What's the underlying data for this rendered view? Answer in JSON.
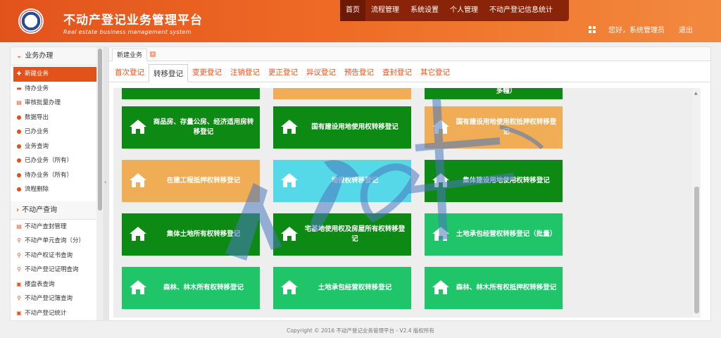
{
  "app": {
    "title": "不动产登记业务管理平台",
    "subtitle": "Real estate business management system"
  },
  "topnav": {
    "items": [
      "首页",
      "流程管理",
      "系统设置",
      "个人管理",
      "不动产登记信息统计"
    ]
  },
  "user": {
    "greeting": "您好，系统管理员",
    "logout": "退出"
  },
  "sidebar": {
    "section1": {
      "title": "业务办理",
      "items": [
        "新建业务",
        "待办业务",
        "审核批量办理",
        "数据导出",
        "已办业务",
        "业务查询",
        "已办业务（所有）",
        "待办业务（所有）",
        "流程删除"
      ]
    },
    "section2": {
      "title": "不动产查询",
      "items": [
        "不动产查封管理",
        "不动产单元查询（分）",
        "不动产权证书查询",
        "不动产登记证明查询",
        "楼盘表查询",
        "不动产登记簿查询",
        "不动产登记统计"
      ]
    }
  },
  "page_tab": {
    "label": "新建业务",
    "close": "x"
  },
  "subtabs": [
    "首次登记",
    "转移登记",
    "变更登记",
    "注销登记",
    "更正登记",
    "异议登记",
    "预告登记",
    "查封登记",
    "其它登记"
  ],
  "partial_top_card": "多幢）",
  "cards": [
    {
      "label": "商品房、存量公房、经济适用房转移登记",
      "color": "#0c8a14"
    },
    {
      "label": "国有建设用地使用权转移登记",
      "color": "#0c8a14"
    },
    {
      "label": "国有建设用地使用权抵押权转移登记",
      "color": "#f0ad55"
    },
    {
      "label": "在建工程抵押权转移登记",
      "color": "#f0ad55"
    },
    {
      "label": "地役权转移登记",
      "color": "#55d8e8"
    },
    {
      "label": "集体建设用地使用权转移登记",
      "color": "#0c8a14"
    },
    {
      "label": "集体土地所有权转移登记",
      "color": "#0c8a14"
    },
    {
      "label": "宅基地使用权及房屋所有权转移登记",
      "color": "#0c8a14"
    },
    {
      "label": "土地承包经营权转移登记（批量）",
      "color": "#20c56a"
    },
    {
      "label": "森林、林木所有权转移登记",
      "color": "#20c56a"
    },
    {
      "label": "土地承包经营权转移登记",
      "color": "#20c56a"
    },
    {
      "label": "森林、林木所有权抵押权转移登记",
      "color": "#20c56a"
    }
  ],
  "footer": "Copyright © 2016   不动产登记业务管理平台 - V2.4   版权所有"
}
